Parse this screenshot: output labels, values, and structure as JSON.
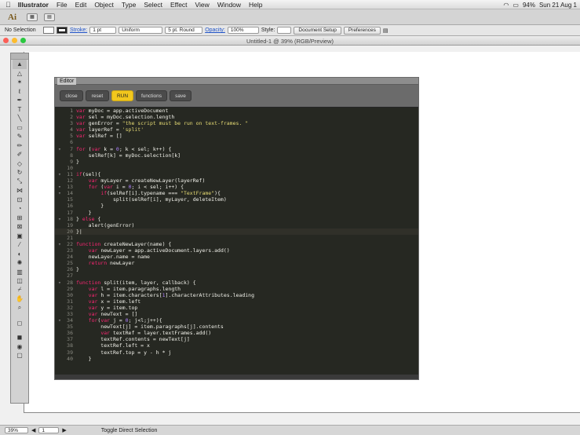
{
  "menubar": {
    "apple": "",
    "items": [
      "Illustrator",
      "File",
      "Edit",
      "Object",
      "Type",
      "Select",
      "Effect",
      "View",
      "Window",
      "Help"
    ],
    "battery": "94%",
    "datetime": "Sun 21 Aug 1"
  },
  "appbar": {
    "logo": "Ai"
  },
  "controlbar": {
    "selection": "No Selection",
    "stroke_label": "Stroke:",
    "stroke_weight": "1 pt",
    "profile": "Uniform",
    "brush": "5 pt. Round",
    "opacity_label": "Opacity:",
    "opacity": "100%",
    "style_label": "Style:",
    "doc_setup": "Document Setup",
    "preferences": "Preferences"
  },
  "window": {
    "title": "Untitled-1 @ 39% (RGB/Preview)"
  },
  "editor": {
    "tab": "Editor",
    "buttons": [
      "close",
      "reset",
      "RUN",
      "functions",
      "save"
    ],
    "lines": [
      {
        "n": "1",
        "t": "var myDoc = app.activeDocument"
      },
      {
        "n": "2",
        "t": "var sel = myDoc.selection.length"
      },
      {
        "n": "3",
        "t": "var genError = \"the script must be run on text-frames. \""
      },
      {
        "n": "4",
        "t": "var layerRef = 'split'"
      },
      {
        "n": "5",
        "t": "var selRef = []"
      },
      {
        "n": "6",
        "t": ""
      },
      {
        "n": "7",
        "t": "for (var k = 0; k < sel; k++) {"
      },
      {
        "n": "8",
        "t": "    selRef[k] = myDoc.selection[k]"
      },
      {
        "n": "9",
        "t": "}"
      },
      {
        "n": "10",
        "t": ""
      },
      {
        "n": "11",
        "t": "if(sel){"
      },
      {
        "n": "12",
        "t": "    var myLayer = createNewLayer(layerRef)"
      },
      {
        "n": "13",
        "t": "    for (var i = 0; i < sel; i++) {"
      },
      {
        "n": "14",
        "t": "        if(selRef[i].typename === \"TextFrame\"){"
      },
      {
        "n": "15",
        "t": "            split(selRef[i], myLayer, deleteItem)"
      },
      {
        "n": "16",
        "t": "        }"
      },
      {
        "n": "17",
        "t": "    }"
      },
      {
        "n": "18",
        "t": "} else {"
      },
      {
        "n": "19",
        "t": "    alert(genError)"
      },
      {
        "n": "20",
        "t": "}|"
      },
      {
        "n": "21",
        "t": ""
      },
      {
        "n": "22",
        "t": "function createNewLayer(name) {"
      },
      {
        "n": "23",
        "t": "    var newLayer = app.activeDocument.layers.add()"
      },
      {
        "n": "24",
        "t": "    newLayer.name = name"
      },
      {
        "n": "25",
        "t": "    return newLayer"
      },
      {
        "n": "26",
        "t": "}"
      },
      {
        "n": "27",
        "t": ""
      },
      {
        "n": "28",
        "t": "function split(item, layer, callback) {"
      },
      {
        "n": "29",
        "t": "    var l = item.paragraphs.length"
      },
      {
        "n": "30",
        "t": "    var h = item.characters[1].characterAttributes.leading"
      },
      {
        "n": "31",
        "t": "    var x = item.left"
      },
      {
        "n": "32",
        "t": "    var y = item.top"
      },
      {
        "n": "33",
        "t": "    var newText = []"
      },
      {
        "n": "34",
        "t": "    for(var j = 0; j<l;j++){"
      },
      {
        "n": "35",
        "t": "        newText[j] = item.paragraphs[j].contents"
      },
      {
        "n": "36",
        "t": "        var textRef = layer.textFrames.add()"
      },
      {
        "n": "37",
        "t": "        textRef.contents = newText[j]"
      },
      {
        "n": "38",
        "t": "        textRef.left = x"
      },
      {
        "n": "39",
        "t": "        textRef.top = y - h * j"
      },
      {
        "n": "40",
        "t": "    }"
      }
    ]
  },
  "statusbar": {
    "zoom": "39%",
    "page": "1",
    "tool": "Toggle Direct Selection"
  }
}
